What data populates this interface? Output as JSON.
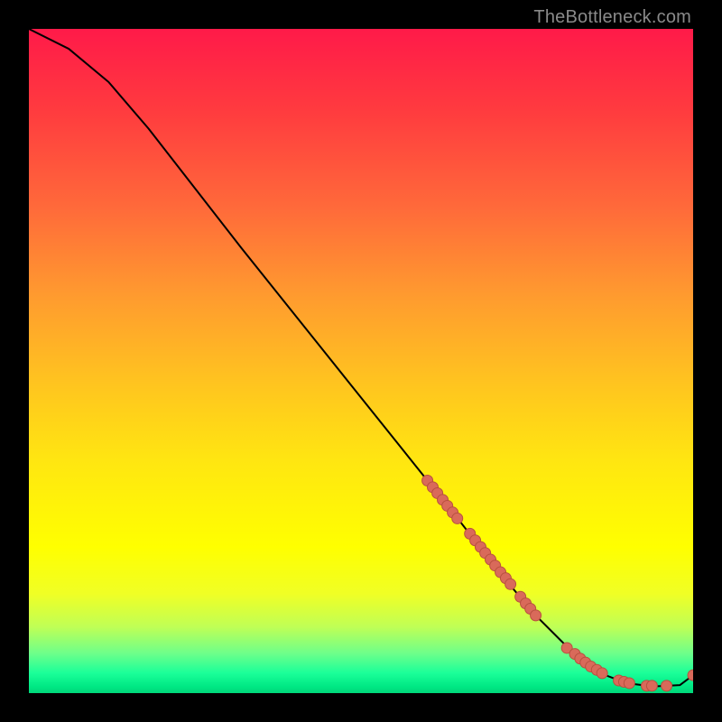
{
  "attribution": "TheBottleneck.com",
  "chart_data": {
    "type": "line",
    "title": "",
    "xlabel": "",
    "ylabel": "",
    "xlim": [
      0,
      100
    ],
    "ylim": [
      0,
      100
    ],
    "curve": {
      "x": [
        0,
        6,
        12,
        18,
        25,
        32,
        40,
        48,
        56,
        64,
        71,
        76,
        80,
        83,
        86,
        90,
        94,
        98,
        100
      ],
      "y": [
        100,
        97,
        92,
        85,
        76,
        67,
        57,
        47,
        37,
        27,
        18,
        12,
        8,
        5,
        3,
        1.5,
        1,
        1.2,
        2.7
      ]
    },
    "markers": {
      "x": [
        60,
        60.8,
        61.5,
        62.3,
        63.0,
        63.8,
        64.5,
        66.4,
        67.2,
        68.0,
        68.7,
        69.5,
        70.2,
        71.0,
        71.8,
        72.5,
        74.0,
        74.8,
        75.5,
        76.3,
        81.0,
        82.2,
        83.0,
        83.8,
        84.6,
        85.5,
        86.3,
        88.8,
        89.6,
        90.4,
        93.0,
        93.8,
        96.0,
        100
      ],
      "y": [
        32.0,
        31.0,
        30.1,
        29.1,
        28.2,
        27.2,
        26.3,
        24.0,
        23.0,
        22.0,
        21.1,
        20.1,
        19.2,
        18.2,
        17.3,
        16.4,
        14.5,
        13.5,
        12.7,
        11.7,
        6.8,
        5.9,
        5.2,
        4.6,
        4.0,
        3.5,
        3.0,
        1.9,
        1.7,
        1.5,
        1.1,
        1.1,
        1.1,
        2.7
      ]
    },
    "colors": {
      "curve": "#000000",
      "marker_fill": "#d96a5a",
      "marker_stroke": "#b8503f"
    }
  }
}
